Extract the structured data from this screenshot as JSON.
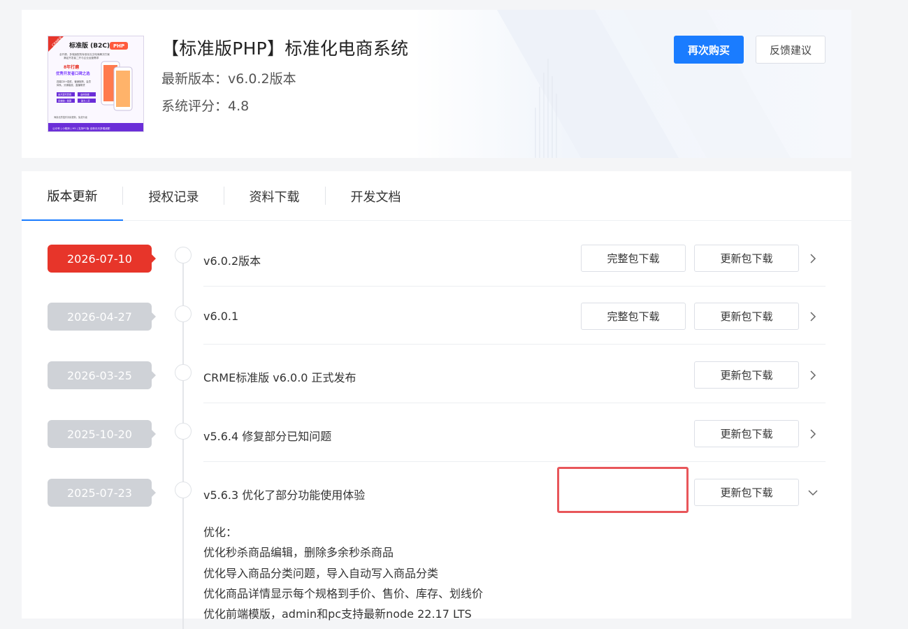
{
  "product": {
    "title": "【标准版PHP】标准化电商系统",
    "version_text": "最新版本：v6.0.2版本",
    "rating_text": "系统评分：4.8",
    "image_alt": "标准版 (B2C) PHP 产品图",
    "image": {
      "corner_badge": "CRMEB",
      "headline": "标准版 (B2C)",
      "php_tag": "PHP",
      "desc_line1": "全开源、多端适配的标准化社交电商解决方案",
      "desc_line2": "满足开发者二开与企业运营需求",
      "slogan_line1": "8年打磨",
      "slogan_line2": "优秀开发者口碑之选",
      "features_line1": "四端口0+插件、营销矩阵、会员",
      "features_line2": "体系、分销裂变、直播带货",
      "tag1": "全开源可商用",
      "tag2": "支持多端",
      "tag3": "多端统一管理",
      "tag4": "助力二开",
      "note": "海量优质插件持续更新，免费升级",
      "footer": "公众号 | 小程序 | H5 | 支持PC版 全新月月多端适配"
    },
    "buttons": {
      "buy_again": "再次购买",
      "feedback": "反馈建议"
    },
    "colors": {
      "primary": "#1a7cff",
      "latest": "#e7352a",
      "inactive_tag": "#cfd2d7",
      "highlight": "#e8565a"
    }
  },
  "tabs": [
    {
      "label": "版本更新",
      "active": true
    },
    {
      "label": "授权记录",
      "active": false
    },
    {
      "label": "资料下载",
      "active": false
    },
    {
      "label": "开发文档",
      "active": false
    }
  ],
  "labels": {
    "full_download": "完整包下载",
    "update_download": "更新包下载"
  },
  "releases": [
    {
      "date": "2026-07-10",
      "title": "v6.0.2版本",
      "has_full": true,
      "expanded": false,
      "latest": true
    },
    {
      "date": "2026-04-27",
      "title": "v6.0.1",
      "has_full": true,
      "expanded": false,
      "latest": false
    },
    {
      "date": "2026-03-25",
      "title": "CRME标准版 v6.0.0 正式发布",
      "has_full": false,
      "expanded": false,
      "latest": false
    },
    {
      "date": "2025-10-20",
      "title": "v5.6.4 修复部分已知问题",
      "has_full": false,
      "expanded": false,
      "latest": false
    },
    {
      "date": "2025-07-23",
      "title": "v5.6.3 优化了部分功能使用体验",
      "has_full": false,
      "expanded": true,
      "latest": false
    }
  ],
  "expanded_notes": [
    "优化：",
    "优化秒杀商品编辑，删除多余秒杀商品",
    "优化导入商品分类问题，导入自动写入商品分类",
    "优化商品详情显示每个规格到手价、售价、库存、划线价",
    "优化前端模版，admin和pc支持最新node 22.17 LTS"
  ]
}
